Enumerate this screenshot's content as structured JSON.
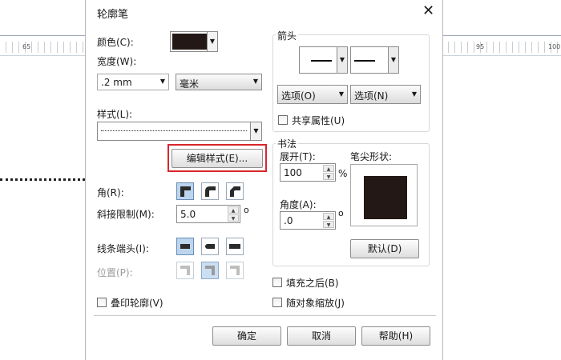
{
  "background": {
    "ruler_numbers": [
      "65",
      "95",
      "100"
    ]
  },
  "dialog": {
    "title": "轮廓笔",
    "close_icon": "close-icon"
  },
  "color": {
    "label": "颜色(C):",
    "swatch": "#231815"
  },
  "width": {
    "label": "宽度(W):",
    "value": ".2 mm",
    "unit": "毫米"
  },
  "style": {
    "label": "样式(L):"
  },
  "edit_style_button": "编辑样式(E)...",
  "corners": {
    "label": "角(R):"
  },
  "miter": {
    "label": "斜接限制(M):",
    "value": "5.0",
    "degree": "o"
  },
  "line_caps": {
    "label": "线条端头(I):"
  },
  "position": {
    "label": "位置(P):"
  },
  "overprint": {
    "label": "叠印轮廓(V)",
    "checked": false
  },
  "arrows": {
    "group_title": "箭头",
    "options_left": "选项(O)",
    "options_right": "选项(N)",
    "share_label": "共享属性(U)",
    "share_checked": false
  },
  "calligraphy": {
    "group_title": "书法",
    "stretch_label": "展开(T):",
    "stretch_value": "100",
    "percent": "%",
    "nib_label": "笔尖形状:",
    "angle_label": "角度(A):",
    "angle_value": ".0",
    "degree": "o",
    "default_button": "默认(D)"
  },
  "after_fill": {
    "label": "填充之后(B)",
    "checked": false
  },
  "scale_with": {
    "label": "随对象缩放(J)",
    "checked": false
  },
  "footer": {
    "ok": "确定",
    "cancel": "取消",
    "help": "帮助(H)"
  },
  "colors": {
    "accent_highlight": "#d9262c",
    "selected_button": "#bcd5ee"
  }
}
